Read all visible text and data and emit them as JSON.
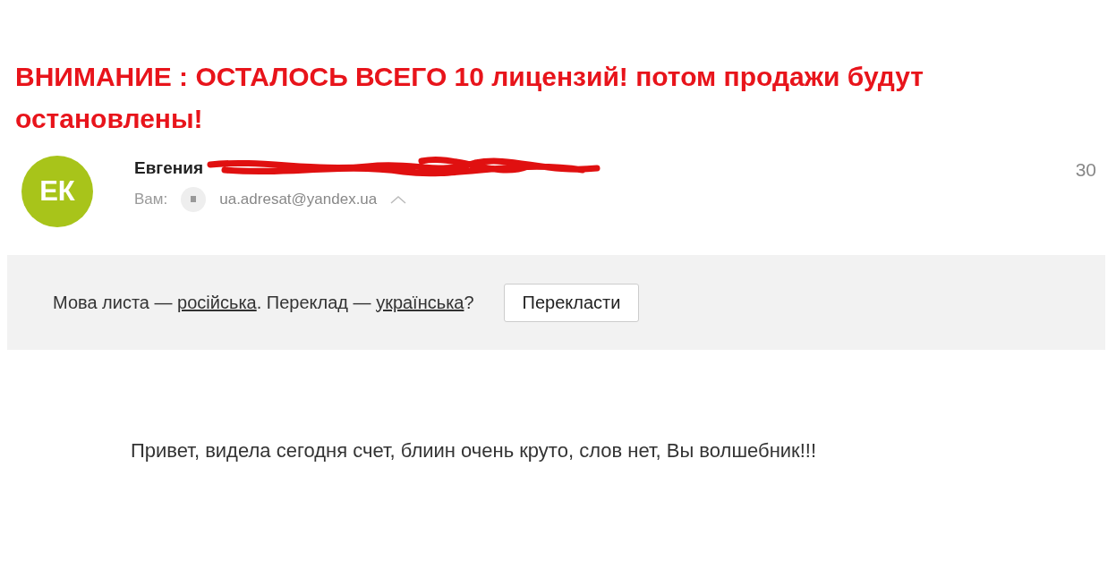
{
  "banner": "ВНИМАНИЕ : ОСТАЛОСЬ ВСЕГО 10 лицензий! потом продажи будут остановлены!",
  "email": {
    "avatar": "ЕК",
    "sender": "Евгения",
    "to_label": "Вам:",
    "recipient": "ua.adresat@yandex.ua",
    "date": "30",
    "translate": {
      "parts": [
        {
          "kind": "text",
          "text": "Мова листа — "
        },
        {
          "kind": "link",
          "text": "російська"
        },
        {
          "kind": "text",
          "text": ". Переклад — "
        },
        {
          "kind": "link",
          "text": "українська"
        },
        {
          "kind": "text",
          "text": "?"
        }
      ],
      "button": "Перекласти"
    },
    "body": "Привет, видела сегодня счет, блиин очень круто, слов нет, Вы волшебник!!!"
  }
}
